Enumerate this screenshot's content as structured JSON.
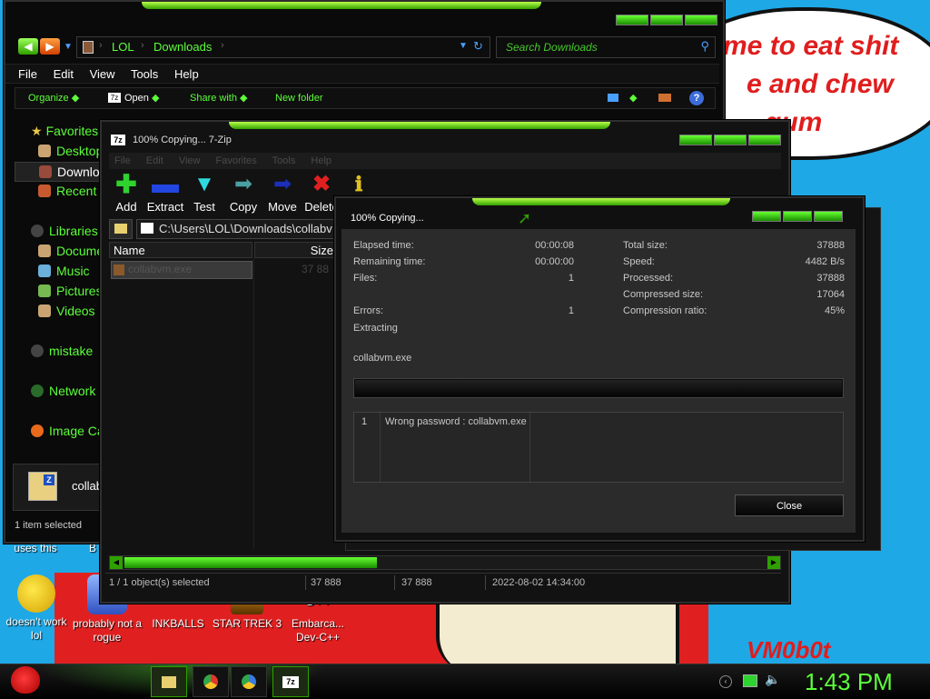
{
  "wallpaper": {
    "bubble_line1": "me to eat shit",
    "bubble_line2": "e and chew",
    "bubble_line3": "gum",
    "signature": "VM0b0t"
  },
  "desktop_icons": [
    {
      "label": "uses this",
      "icon": "unknown-icon"
    },
    {
      "label": "B",
      "icon": "unknown-icon"
    },
    {
      "label": "doesn't work lol",
      "icon": "yahoo-messenger-icon"
    },
    {
      "label": "probably not a rogue",
      "icon": "installer-icon"
    },
    {
      "label": "INKBALLS",
      "icon": "inkballs-icon"
    },
    {
      "label": "STAR TREK 3",
      "icon": "star-trek-icon"
    },
    {
      "label": "Embarca... Dev-C++",
      "icon": "devcpp-icon"
    }
  ],
  "explorer": {
    "address": [
      "LOL",
      "Downloads"
    ],
    "search_placeholder": "Search Downloads",
    "menu": [
      "File",
      "Edit",
      "View",
      "Tools",
      "Help"
    ],
    "toolbar": [
      "Organize",
      "Open",
      "Share with",
      "New folder"
    ],
    "nav": {
      "favorites": "Favorites",
      "desktop": "Desktop",
      "downloads": "Downloads",
      "recent": "Recent",
      "libraries": "Libraries",
      "documents": "Documents",
      "music": "Music",
      "pictures": "Pictures",
      "videos": "Videos",
      "mistake": "mistake",
      "network": "Network",
      "image_capture": "Image Ca"
    },
    "details_file": "collab",
    "status": "1 item selected"
  },
  "sevenzip": {
    "title": "100% Copying... 7-Zip",
    "menu": [
      "File",
      "Edit",
      "View",
      "Favorites",
      "Tools",
      "Help"
    ],
    "toolbar": [
      {
        "label": "Add",
        "icon": "plus-icon",
        "color": "#2fd22f"
      },
      {
        "label": "Extract",
        "icon": "minus-icon",
        "color": "#2246e0"
      },
      {
        "label": "Test",
        "icon": "check-icon",
        "color": "#2fd9e0"
      },
      {
        "label": "Copy",
        "icon": "copy-arrow-icon",
        "color": "#4aa0a0"
      },
      {
        "label": "Move",
        "icon": "move-arrow-icon",
        "color": "#1c2fb8"
      },
      {
        "label": "Delete",
        "icon": "delete-x-icon",
        "color": "#e02020"
      },
      {
        "label": "Info",
        "icon": "info-icon",
        "color": "#e0c020"
      }
    ],
    "path": "C:\\Users\\LOL\\Downloads\\collabv",
    "columns": [
      "Name",
      "Size"
    ],
    "file": {
      "name": "collabvm.exe",
      "size": "37 88"
    },
    "status": {
      "selected": "1 / 1 object(s) selected",
      "size1": "37 888",
      "size2": "37 888",
      "date": "2022-08-02 14:34:00"
    }
  },
  "progress": {
    "title": "100% Copying...",
    "left": [
      {
        "label": "Elapsed time:",
        "value": "00:00:08"
      },
      {
        "label": "Remaining time:",
        "value": "00:00:00"
      },
      {
        "label": "Files:",
        "value": "1"
      },
      {
        "label": "Errors:",
        "value": "1"
      },
      {
        "label": "Extracting",
        "value": ""
      }
    ],
    "right": [
      {
        "label": "Total size:",
        "value": "37888"
      },
      {
        "label": "Speed:",
        "value": "4482 B/s"
      },
      {
        "label": "Processed:",
        "value": "37888"
      },
      {
        "label": "Compressed size:",
        "value": "17064"
      },
      {
        "label": "Compression ratio:",
        "value": "45%"
      }
    ],
    "current_file": "collabvm.exe",
    "progress_fraction": 1.0,
    "log_num": "1",
    "log_msg": "Wrong password : collabvm.exe",
    "close_label": "Close"
  },
  "taskbar": {
    "time": "1:43 PM",
    "apps": [
      "file-explorer-icon",
      "chrome-icon",
      "chromium-icon",
      "7zip-icon"
    ]
  },
  "colors": {
    "accent_green": "#5cff3a",
    "window_bg": "#0a0a0a",
    "dialog_bg": "#2b2b2b",
    "wallpaper_blue": "#1fa8e6"
  }
}
